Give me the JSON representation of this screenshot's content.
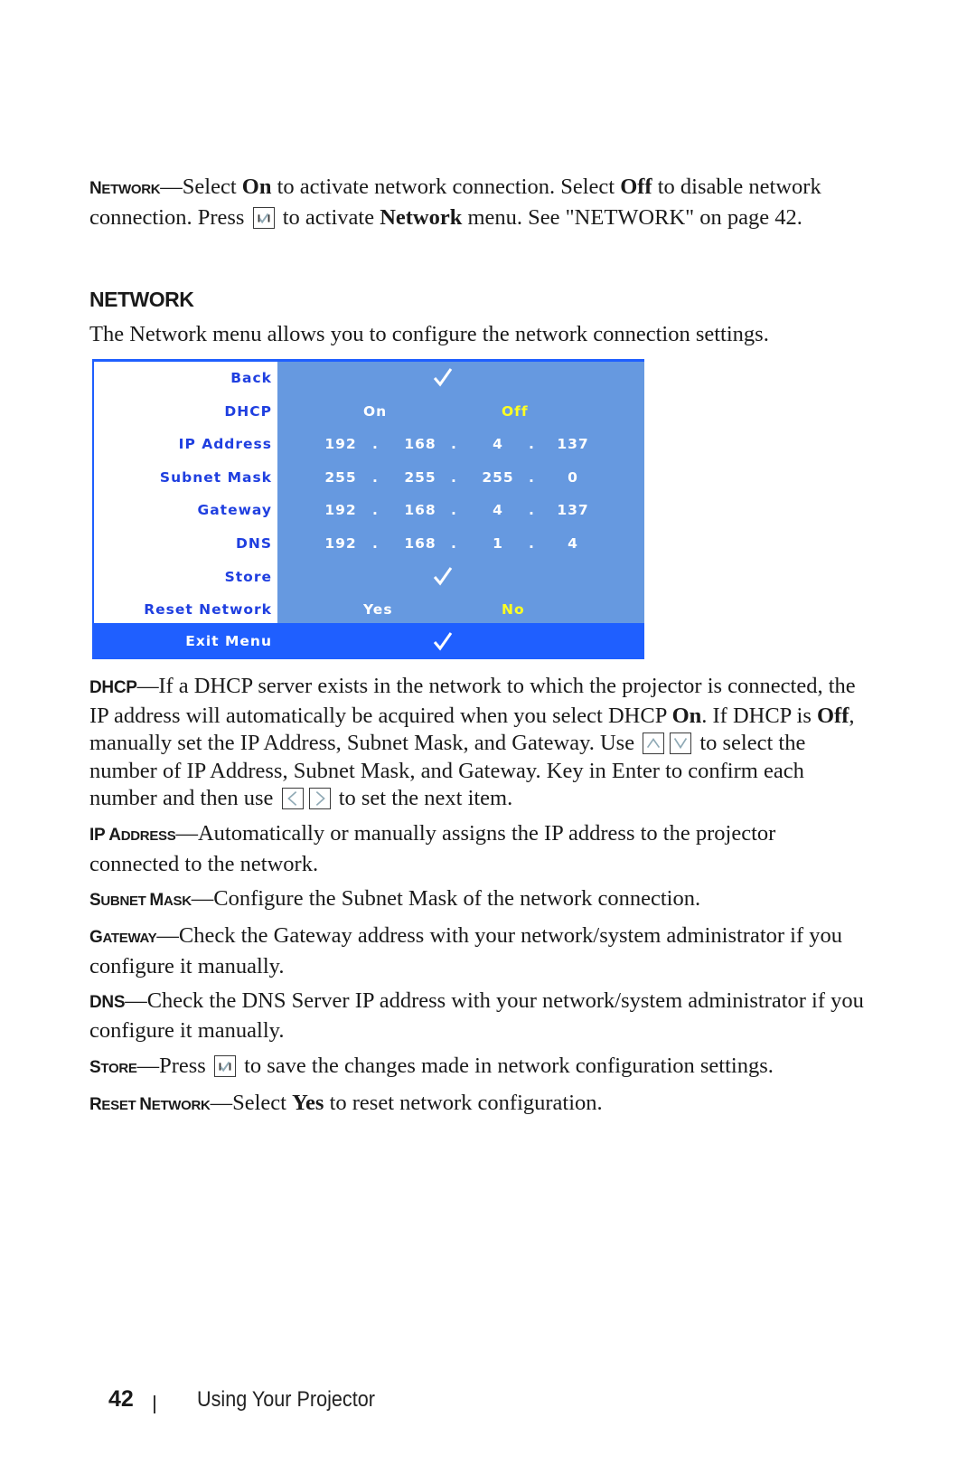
{
  "intro": {
    "lead": "Network",
    "text_1": "Select ",
    "on": "On",
    "text_2": " to activate network connection. Select ",
    "off": "Off",
    "text_3": " to disable network connection. Press ",
    "text_4": " to activate ",
    "network": "Network",
    "text_5": " menu. See \"NETWORK\" on page 42."
  },
  "section": {
    "heading": "NETWORK",
    "description": "The Network menu allows you to configure the network connection settings."
  },
  "osd_menu": {
    "rows": [
      {
        "label": "Back",
        "type": "check"
      },
      {
        "label": "DHCP",
        "options": [
          "On",
          "Off"
        ],
        "selected": "Off"
      },
      {
        "label": "IP Address",
        "octets": [
          "192",
          "168",
          "4",
          "137"
        ]
      },
      {
        "label": "Subnet Mask",
        "octets": [
          "255",
          "255",
          "255",
          "0"
        ]
      },
      {
        "label": "Gateway",
        "octets": [
          "192",
          "168",
          "4",
          "137"
        ]
      },
      {
        "label": "DNS",
        "octets": [
          "192",
          "168",
          "1",
          "4"
        ]
      },
      {
        "label": "Store",
        "type": "check"
      },
      {
        "label": "Reset Network",
        "options": [
          "Yes",
          "No"
        ],
        "selected": "No"
      }
    ],
    "exit_label": "Exit Menu",
    "dot": ".",
    "colors": {
      "label": "#1f3fe0",
      "value_bg": "#6699e0",
      "highlight": "#1f5fff",
      "selected": "#ffff22"
    }
  },
  "descriptions": {
    "dhcp": {
      "lead": "DHCP",
      "t1": "If a DHCP server exists in the network to which the projector is connected, the IP address will automatically be acquired when you select DHCP ",
      "on": "On",
      "t2": ". If DHCP is ",
      "off": "Off",
      "t3": ", manually set the IP Address, Subnet Mask, and Gateway. Use ",
      "t4": " to select the number of IP Address, Subnet Mask, and Gateway. Key in Enter to confirm each number and then use ",
      "t5": " to set the next item."
    },
    "ip": {
      "lead_big": "IP A",
      "lead_small": "DDRESS",
      "text": "Automatically or manually assigns the IP address to the projector connected to the network."
    },
    "subnet": {
      "lead_big1": "S",
      "lead_small1": "UBNET ",
      "lead_big2": "M",
      "lead_small2": "ASK",
      "text": "Configure the Subnet Mask of the network connection."
    },
    "gateway": {
      "lead_big": "G",
      "lead_small": "ATEWAY",
      "text": "Check the Gateway address with your network/system administrator if you configure it manually."
    },
    "dns": {
      "lead": "DNS",
      "text": "Check the DNS Server IP address with your network/system administrator if you configure it manually."
    },
    "store": {
      "lead_big": "S",
      "lead_small": "TORE",
      "t1": "Press ",
      "t2": " to save the changes made in network configuration settings."
    },
    "reset": {
      "lead_big1": "R",
      "lead_small1": "ESET ",
      "lead_big2": "N",
      "lead_small2": "ETWORK",
      "t1": "Select ",
      "yes": "Yes",
      "t2": " to reset network configuration."
    }
  },
  "dash": "—",
  "icons": [
    "check-button-icon",
    "up-arrow-button-icon",
    "down-arrow-button-icon",
    "left-arrow-button-icon",
    "right-arrow-button-icon",
    "checkmark-icon"
  ],
  "footer": {
    "page_number": "42",
    "section_title": "Using Your Projector"
  }
}
